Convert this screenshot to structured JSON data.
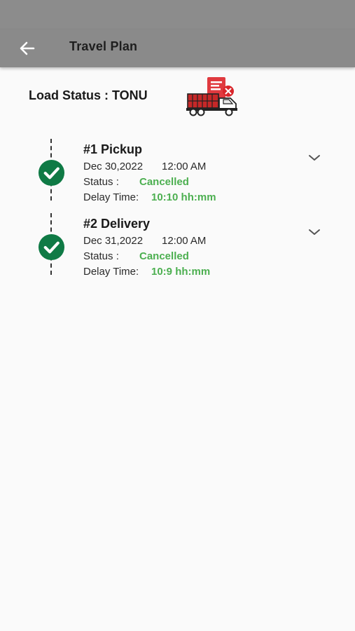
{
  "header": {
    "title": "Travel Plan",
    "back_icon": "arrow-left-icon"
  },
  "load": {
    "status_text": "Load Status : TONU",
    "icon": "truck-cancelled-document-icon"
  },
  "stops": [
    {
      "title": "#1  Pickup",
      "date": "Dec 30,2022",
      "time": "12:00 AM",
      "status_label": "Status :",
      "status_value": "Cancelled",
      "delay_label": "Delay Time:",
      "delay_value": "10:10 hh:mm",
      "check_icon": "check-circle-icon",
      "expand_icon": "chevron-down-icon"
    },
    {
      "title": "#2  Delivery",
      "date": "Dec 31,2022",
      "time": "12:00 AM",
      "status_label": "Status :",
      "status_value": "Cancelled",
      "delay_label": "Delay Time:",
      "delay_value": "10:9 hh:mm",
      "check_icon": "check-circle-icon",
      "expand_icon": "chevron-down-icon"
    }
  ],
  "colors": {
    "appbar": "#8a8a8a",
    "check": "#0f7a45",
    "status_value": "#4caf50",
    "truck_red": "#d9262b"
  }
}
